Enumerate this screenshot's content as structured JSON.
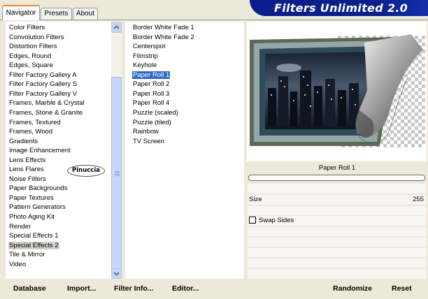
{
  "tabs": [
    "Navigator",
    "Presets",
    "About"
  ],
  "banner": "Filters Unlimited 2.0",
  "categories": [
    "Color Filters",
    "Convolution Filters",
    "Distortion Filters",
    "Edges, Round",
    "Edges, Square",
    "Filter Factory Gallery A",
    "Filter Factory Gallery S",
    "Filter Factory Gallery V",
    "Frames, Marble & Crystal",
    "Frames, Stone & Granite",
    "Frames, Textured",
    "Frames, Wood",
    "Gradients",
    "Image Enhancement",
    "Lens Effects",
    "Lens Flares",
    "Noise Filters",
    "Paper Backgrounds",
    "Paper Textures",
    "Pattern Generators",
    "Photo Aging Kit",
    "Render",
    "Special Effects 1",
    "Special Effects 2",
    "Tile & Mirror",
    "Video"
  ],
  "selected_category_index": 23,
  "filters": [
    "Border White Fade 1",
    "Border White Fade 2",
    "Centerspot",
    "Filmstrip",
    "Keyhole",
    "Paper Roll 1",
    "Paper Roll 2",
    "Paper Roll 3",
    "Paper Roll 4",
    "Puzzle (scaled)",
    "Puzzle (tiled)",
    "Rainbow",
    "TV Screen"
  ],
  "selected_filter_index": 5,
  "stamp": "Pinuccia",
  "filter_name": "Paper Roll 1",
  "size": {
    "label": "Size",
    "value": "255"
  },
  "swap_sides": {
    "label": "Swap Sides",
    "checked": false
  },
  "buttons": {
    "database": "Database",
    "import": "Import...",
    "filter_info": "Filter Info...",
    "editor": "Editor...",
    "randomize": "Randomize",
    "reset": "Reset"
  }
}
